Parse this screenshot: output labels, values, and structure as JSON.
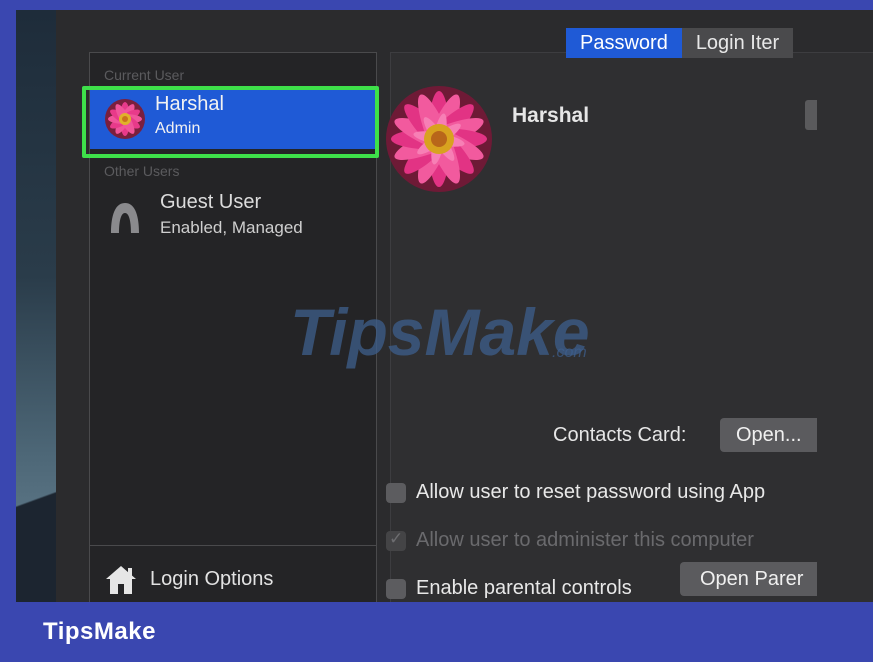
{
  "sidebar": {
    "current_user_label": "Current User",
    "other_users_label": "Other Users",
    "current_user": {
      "name": "Harshal",
      "role": "Admin",
      "avatar_icon": "flower-avatar-icon"
    },
    "guest_user": {
      "name": "Guest User",
      "status": "Enabled, Managed",
      "icon": "guest-user-icon"
    },
    "login_options": {
      "label": "Login Options",
      "icon": "house-icon"
    }
  },
  "tabs": [
    {
      "label": "Password",
      "active": true
    },
    {
      "label": "Login Iter",
      "active": false
    }
  ],
  "pane": {
    "user_name": "Harshal",
    "contacts_label": "Contacts Card:",
    "open_button": "Open...",
    "options": [
      {
        "label": "Allow user to reset password using App",
        "checked": false,
        "enabled": true
      },
      {
        "label": "Allow user to administer this computer",
        "checked": true,
        "enabled": false
      },
      {
        "label": "Enable parental controls",
        "checked": false,
        "enabled": true
      }
    ],
    "parental_button": "Open Parer"
  },
  "watermark": {
    "text": "TipsMake",
    "suffix": ".com"
  },
  "footer": {
    "brand": "TipsMake"
  },
  "colors": {
    "accent": "#1f5ad6",
    "highlight": "#3ee04a",
    "frame": "#3a47b0"
  }
}
